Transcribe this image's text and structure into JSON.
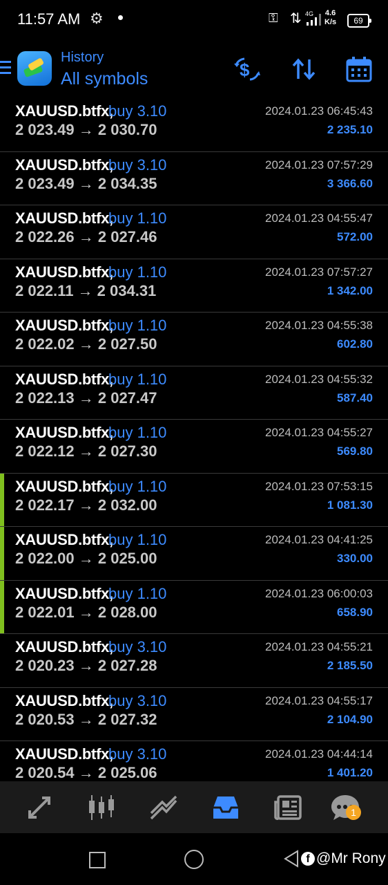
{
  "status_bar": {
    "time": "11:57 AM",
    "network": "4G",
    "speed_value": "4.6",
    "speed_unit": "K/s",
    "battery": "69"
  },
  "header": {
    "subtitle": "History",
    "title": "All symbols",
    "icons": [
      "menu-icon",
      "app-logo",
      "currency-swap-icon",
      "sort-icon",
      "calendar-icon"
    ],
    "accent_color": "#3d8bff"
  },
  "trades": [
    {
      "symbol": "XAUUSD.btfx,",
      "type": "buy 3.10",
      "time": "2024.01.23 06:45:43",
      "prices": "2 023.49 → 2 030.70",
      "profit": "2 235.10",
      "marker": false
    },
    {
      "symbol": "XAUUSD.btfx,",
      "type": "buy 3.10",
      "time": "2024.01.23 07:57:29",
      "prices": "2 023.49 → 2 034.35",
      "profit": "3 366.60",
      "marker": false
    },
    {
      "symbol": "XAUUSD.btfx,",
      "type": "buy 1.10",
      "time": "2024.01.23 04:55:47",
      "prices": "2 022.26 → 2 027.46",
      "profit": "572.00",
      "marker": false
    },
    {
      "symbol": "XAUUSD.btfx,",
      "type": "buy 1.10",
      "time": "2024.01.23 07:57:27",
      "prices": "2 022.11 → 2 034.31",
      "profit": "1 342.00",
      "marker": false
    },
    {
      "symbol": "XAUUSD.btfx,",
      "type": "buy 1.10",
      "time": "2024.01.23 04:55:38",
      "prices": "2 022.02 → 2 027.50",
      "profit": "602.80",
      "marker": false
    },
    {
      "symbol": "XAUUSD.btfx,",
      "type": "buy 1.10",
      "time": "2024.01.23 04:55:32",
      "prices": "2 022.13 → 2 027.47",
      "profit": "587.40",
      "marker": false
    },
    {
      "symbol": "XAUUSD.btfx,",
      "type": "buy 1.10",
      "time": "2024.01.23 04:55:27",
      "prices": "2 022.12 → 2 027.30",
      "profit": "569.80",
      "marker": false
    },
    {
      "symbol": "XAUUSD.btfx,",
      "type": "buy 1.10",
      "time": "2024.01.23 07:53:15",
      "prices": "2 022.17 → 2 032.00",
      "profit": "1 081.30",
      "marker": true
    },
    {
      "symbol": "XAUUSD.btfx,",
      "type": "buy 1.10",
      "time": "2024.01.23 04:41:25",
      "prices": "2 022.00 → 2 025.00",
      "profit": "330.00",
      "marker": true
    },
    {
      "symbol": "XAUUSD.btfx,",
      "type": "buy 1.10",
      "time": "2024.01.23 06:00:03",
      "prices": "2 022.01 → 2 028.00",
      "profit": "658.90",
      "marker": true
    },
    {
      "symbol": "XAUUSD.btfx,",
      "type": "buy 3.10",
      "time": "2024.01.23 04:55:21",
      "prices": "2 020.23 → 2 027.28",
      "profit": "2 185.50",
      "marker": false
    },
    {
      "symbol": "XAUUSD.btfx,",
      "type": "buy 3.10",
      "time": "2024.01.23 04:55:17",
      "prices": "2 020.53 → 2 027.32",
      "profit": "2 104.90",
      "marker": false
    },
    {
      "symbol": "XAUUSD.btfx,",
      "type": "buy 3.10",
      "time": "2024.01.23 04:44:14",
      "prices": "2 020.54 → 2 025.06",
      "profit": "1 401.20",
      "marker": false
    }
  ],
  "tabbar": {
    "tabs": [
      "quotes-tab",
      "chart-tab",
      "trade-tab",
      "history-tab",
      "news-tab",
      "chat-tab"
    ],
    "active": "history-tab",
    "chat_badge": "1"
  },
  "watermark": {
    "text": "@Mr Rony"
  }
}
